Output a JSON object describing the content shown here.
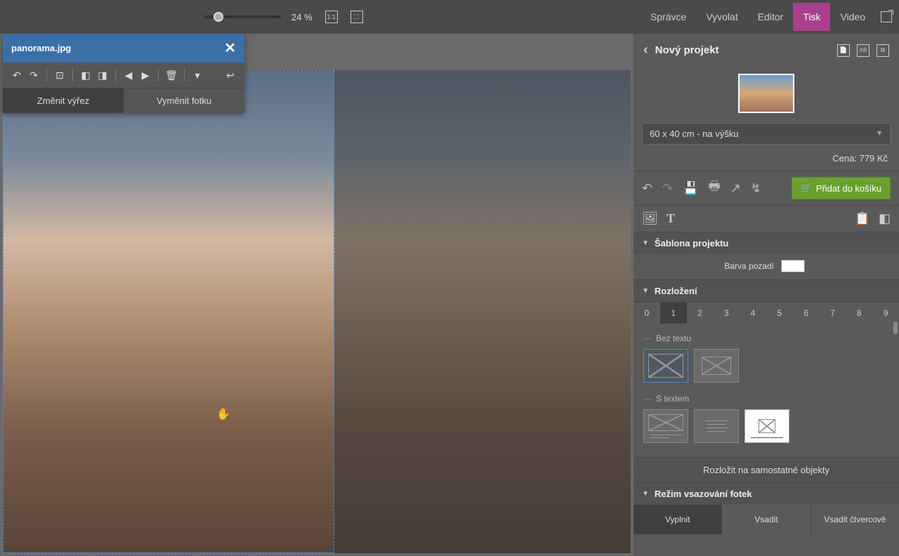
{
  "topbar": {
    "zoom_pct": "24 %",
    "menu": [
      "Správce",
      "Vyvolat",
      "Editor",
      "Tisk",
      "Video"
    ],
    "active_menu": "Tisk"
  },
  "floating_panel": {
    "filename": "panorama.jpg",
    "tab_crop": "Změnit výřez",
    "tab_swap": "Vyměnit fotku"
  },
  "sidebar": {
    "title": "Nový projekt",
    "size_option": "60 x 40 cm - na výšku",
    "price": "Cena: 779 Kč",
    "add_to_cart": "Přidat do košíku",
    "sections": {
      "template": "Šablona projektu",
      "bg_color": "Barva pozadí",
      "layout": "Rozložení",
      "no_text": "Bez textu",
      "with_text": "S textem",
      "split": "Rozložit na samostatné objekty",
      "fit_mode": "Režim vsazování fotek"
    },
    "layout_numbers": [
      "0",
      "1",
      "2",
      "3",
      "4",
      "5",
      "6",
      "7",
      "8",
      "9"
    ],
    "layout_active": "1",
    "fit_modes": {
      "fill": "Vyplnit",
      "fit": "Vsadit",
      "fit_square": "Vsadit čtvercově"
    },
    "fit_active": "fill"
  }
}
